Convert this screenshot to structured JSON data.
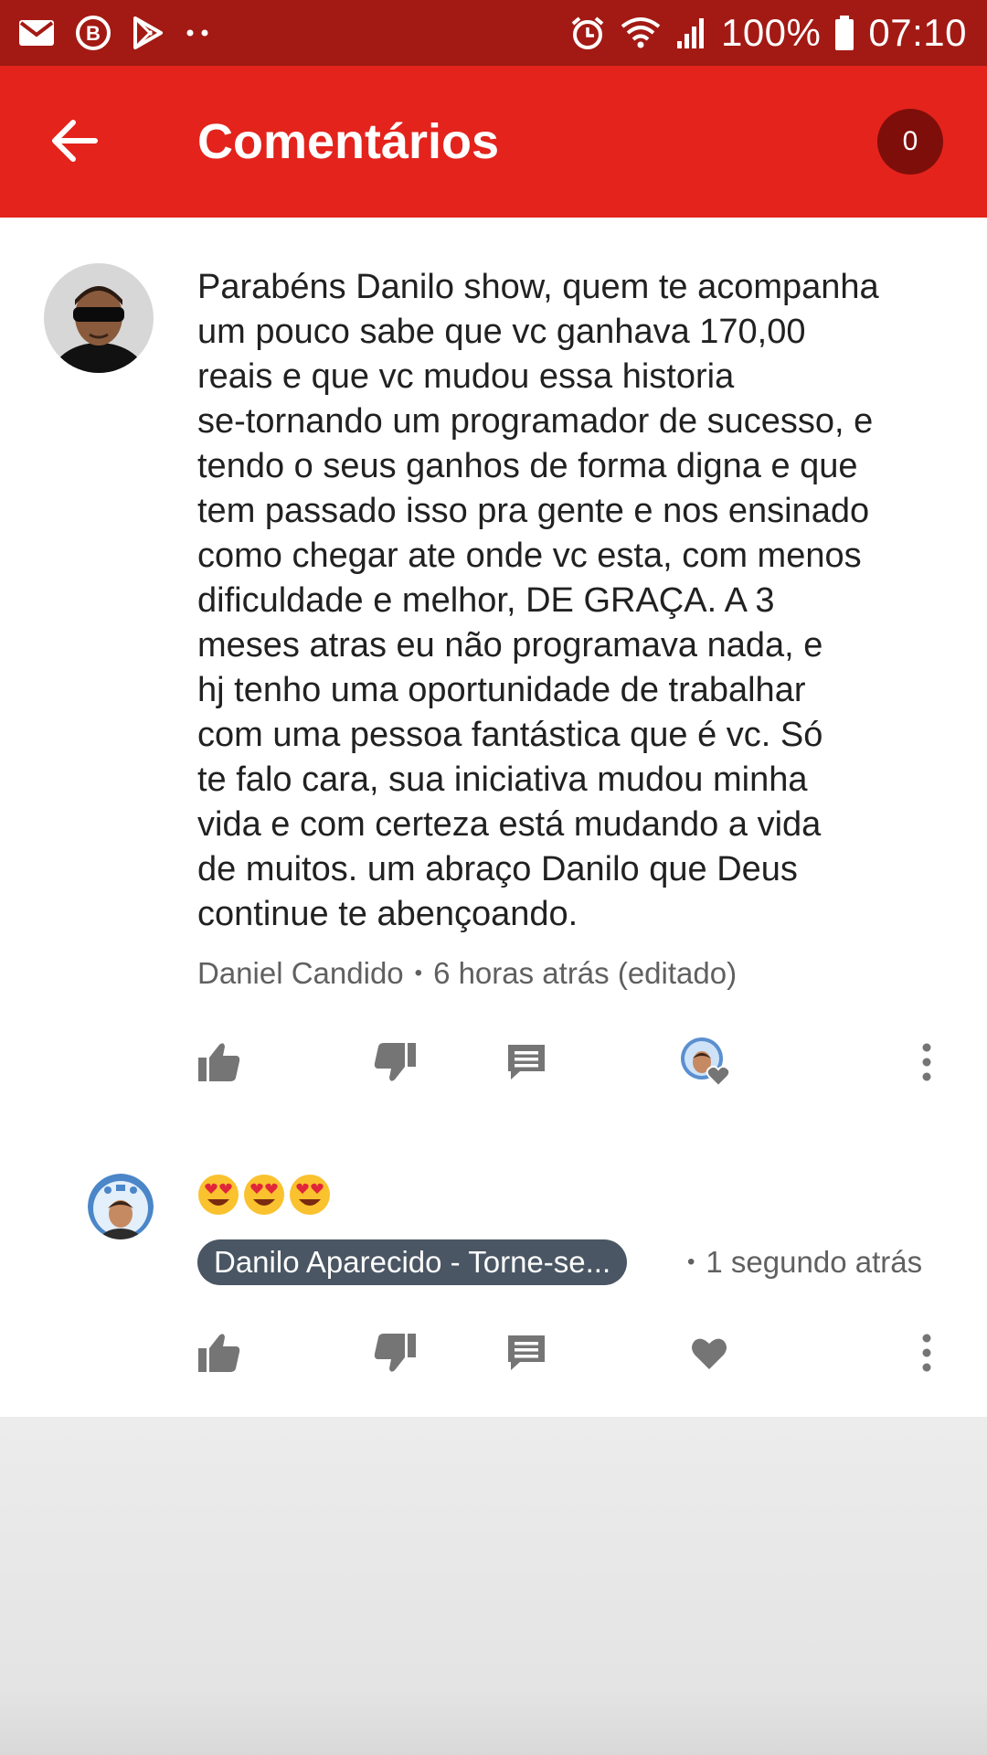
{
  "status_bar": {
    "battery": "100%",
    "time": "07:10",
    "icons": [
      "email-icon",
      "b-app-icon",
      "play-store-icon",
      "more-dots-icon",
      "alarm-icon",
      "wifi-icon",
      "signal-icon",
      "battery-icon"
    ]
  },
  "header": {
    "title": "Comentários",
    "count": "0"
  },
  "comment": {
    "text": "Parabéns Danilo show, quem te acompanha\num pouco sabe que vc ganhava 170,00\nreais e que vc mudou essa historia\nse-tornando um programador de sucesso, e\ntendo o seus ganhos de forma digna e que\ntem passado isso pra gente e nos ensinado\ncomo chegar ate onde vc esta, com menos\ndificuldade e melhor, DE GRAÇA.  A 3\nmeses atras eu não programava nada, e\nhj tenho uma oportunidade de trabalhar\ncom uma pessoa fantástica que é vc. Só\nte falo cara, sua iniciativa mudou minha\nvida e com certeza está mudando a vida\nde muitos. um abraço Danilo que Deus\ncontinue te abençoando.",
    "author": "Daniel Candido",
    "separator": "•",
    "time": "6 horas atrás (editado)"
  },
  "reply": {
    "text": "😍😍😍",
    "author": "Danilo Aparecido - Torne-se...",
    "separator": "•",
    "time": "1 segundo atrás"
  },
  "colors": {
    "status_bar": "#a31a14",
    "app_bar": "#e3231c",
    "badge": "#7e0e0a",
    "author_chip": "#4a5663",
    "icon_gray": "#757575"
  }
}
